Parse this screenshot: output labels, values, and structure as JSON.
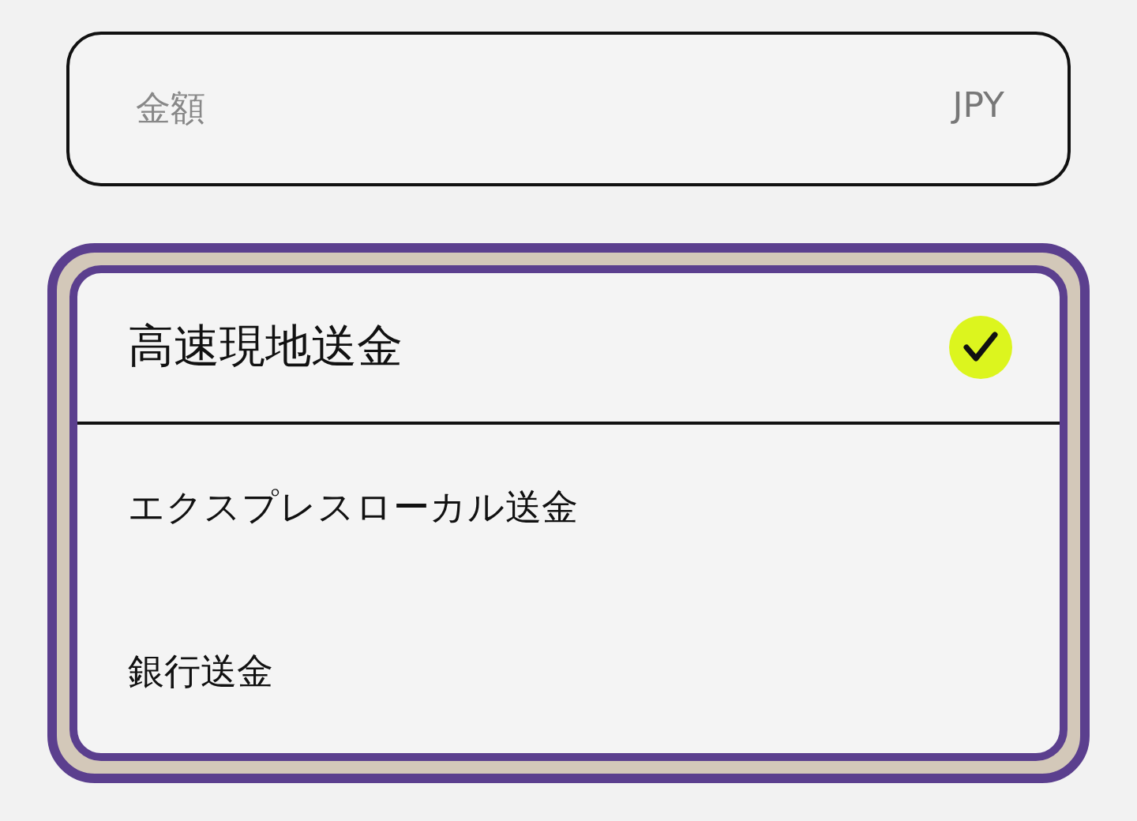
{
  "amount_field": {
    "placeholder": "金額",
    "currency": "JPY"
  },
  "transfer_options": [
    {
      "label": "高速現地送金",
      "selected": true
    },
    {
      "label": "エクスプレスローカル送金",
      "selected": false
    },
    {
      "label": "銀行送金",
      "selected": false
    }
  ]
}
